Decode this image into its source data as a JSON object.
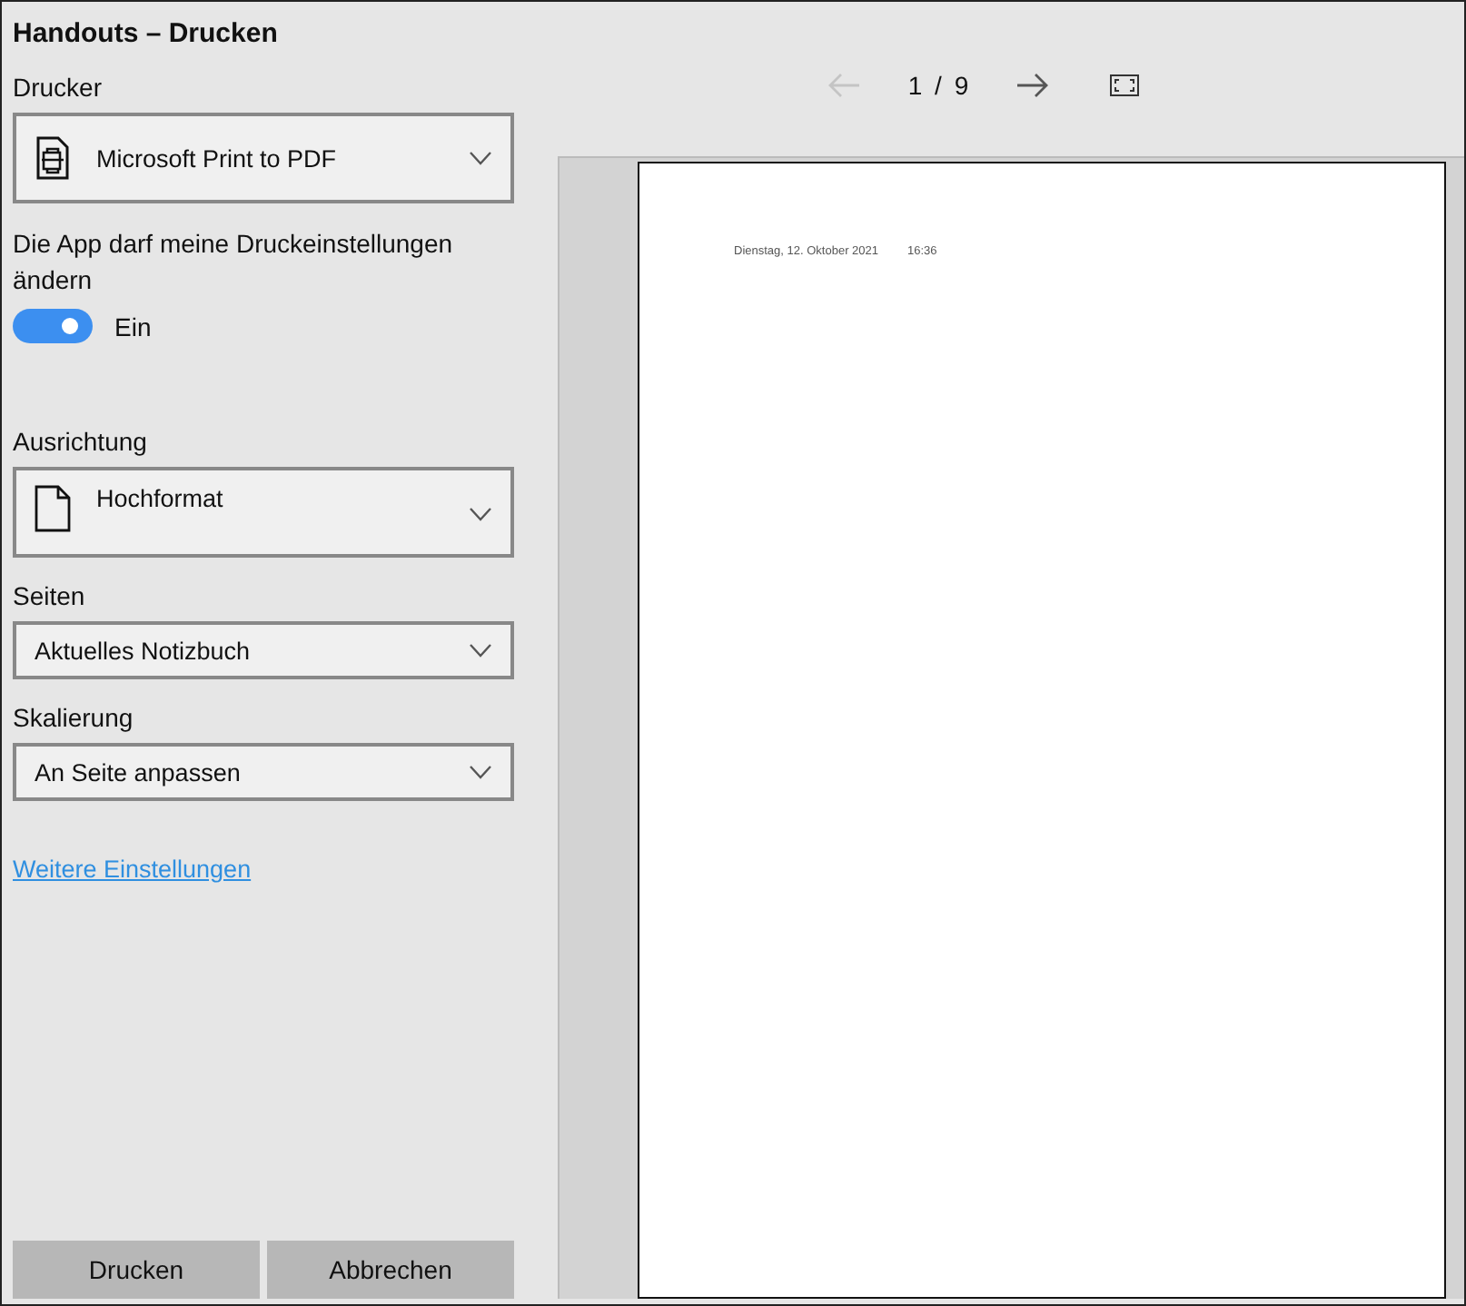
{
  "window": {
    "title": "Handouts – Drucken"
  },
  "printer": {
    "label": "Drucker",
    "value": "Microsoft Print to PDF"
  },
  "permission": {
    "label": "Die App darf meine Druckeinstellungen ändern",
    "on": true,
    "state_text": "Ein"
  },
  "orientation": {
    "label": "Ausrichtung",
    "value": "Hochformat"
  },
  "pages": {
    "label": "Seiten",
    "value": "Aktuelles Notizbuch"
  },
  "scaling": {
    "label": "Skalierung",
    "value": "An Seite anpassen"
  },
  "more_link": "Weitere Einstellungen",
  "buttons": [
    "Drucken",
    "Abbrechen"
  ],
  "preview": {
    "prev_disabled": true,
    "next_disabled": false,
    "page_indicator": "1 / 9",
    "header_date": "Dienstag, 12. Oktober 2021",
    "header_time": "16:36"
  }
}
